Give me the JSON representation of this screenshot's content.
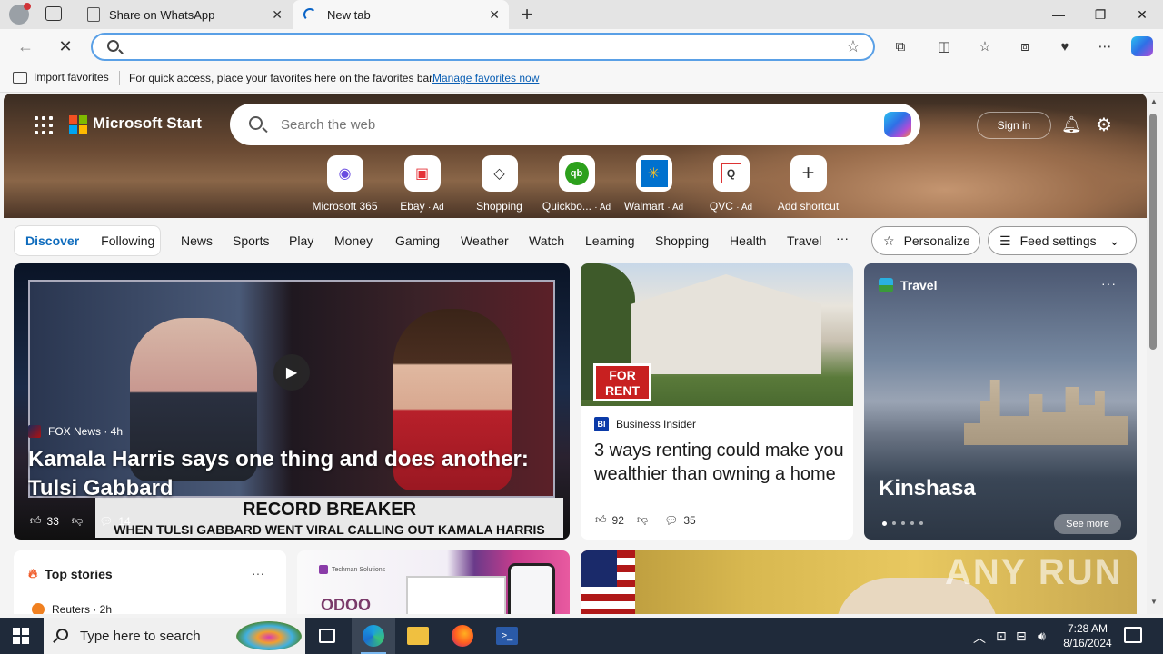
{
  "browser": {
    "tabs": [
      {
        "label": "Share on WhatsApp",
        "active": false
      },
      {
        "label": "New tab",
        "active": true
      }
    ],
    "address_value": "",
    "window_controls": [
      "minimize",
      "restore",
      "close"
    ]
  },
  "favorites_bar": {
    "import_label": "Import favorites",
    "message": "For quick access, place your favorites here on the favorites bar.",
    "link": "Manage favorites now"
  },
  "header": {
    "brand": "Microsoft Start",
    "search_placeholder": "Search the web",
    "signin": "Sign in"
  },
  "shortcuts": [
    {
      "label": "Microsoft 365",
      "ad": ""
    },
    {
      "label": "Ebay",
      "ad": "· Ad"
    },
    {
      "label": "Shopping",
      "ad": ""
    },
    {
      "label": "Quickbo...",
      "ad": "· Ad"
    },
    {
      "label": "Walmart",
      "ad": "· Ad"
    },
    {
      "label": "QVC",
      "ad": "· Ad"
    },
    {
      "label": "Add shortcut",
      "ad": ""
    }
  ],
  "feed_nav": {
    "discover": "Discover",
    "following": "Following",
    "categories": [
      "News",
      "Sports",
      "Play",
      "Money",
      "Gaming",
      "Weather",
      "Watch",
      "Learning",
      "Shopping",
      "Health",
      "Travel"
    ],
    "more": "···",
    "personalize": "Personalize",
    "feed_settings": "Feed settings"
  },
  "cards": {
    "main": {
      "source": "FOX News · 4h",
      "headline": "Kamala Harris says one thing and does another: Tulsi Gabbard",
      "likes": "33",
      "comments": "14",
      "chyron": "RECORD BREAKER",
      "chyron_sub": "WHEN TULSI GABBARD WENT VIRAL CALLING OUT KAMALA HARRIS"
    },
    "bi": {
      "sign": "FOR RENT",
      "source": "Business Insider",
      "headline": "3 ways renting could make you wealthier than owning a home",
      "likes": "92",
      "comments": "35"
    },
    "travel": {
      "category": "Travel",
      "city": "Kinshasa",
      "see_more": "See more"
    },
    "top_stories": {
      "title": "Top stories",
      "first_source": "Reuters · 2h"
    },
    "ad": {
      "brand_small": "Techman Solutions",
      "brand": "ODOO"
    }
  },
  "watermark": "ANY RUN",
  "taskbar": {
    "search_placeholder": "Type here to search",
    "time": "7:28 AM",
    "date": "8/16/2024"
  }
}
